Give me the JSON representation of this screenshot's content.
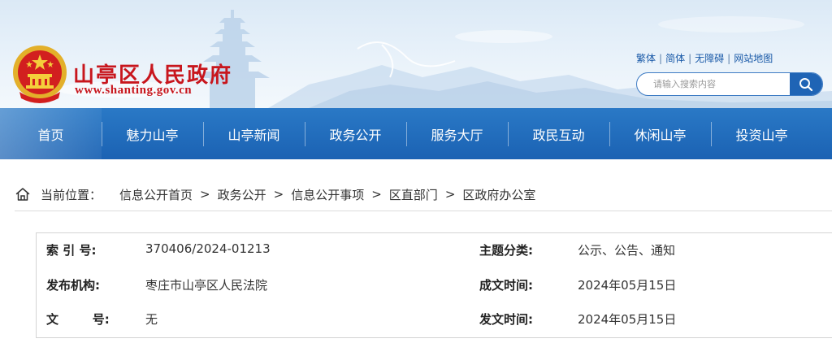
{
  "site": {
    "title": "山亭区人民政府",
    "url": "www.shanting.gov.cn"
  },
  "util_links": [
    "繁体",
    "简体",
    "无障碍",
    "网站地图"
  ],
  "search": {
    "placeholder": "请输入搜索内容",
    "icon": "search-icon"
  },
  "nav": {
    "items": [
      "首页",
      "魅力山亭",
      "山亭新闻",
      "政务公开",
      "服务大厅",
      "政民互动",
      "休闲山亭",
      "投资山亭"
    ],
    "active_index": 0
  },
  "breadcrumb": {
    "prefix": "当前位置：",
    "items": [
      "信息公开首页",
      "政务公开",
      "信息公开事项",
      "区直部门",
      "区政府办公室"
    ],
    "separator": ">",
    "icon": "home-icon"
  },
  "info": {
    "rows": [
      {
        "label1": "索 引 号:",
        "value1": "370406/2024-01213",
        "label2": "主题分类:",
        "value2": "公示、公告、通知"
      },
      {
        "label1": "发布机构:",
        "value1": "枣庄市山亭区人民法院",
        "label2": "成文时间:",
        "value2": "2024年05月15日"
      },
      {
        "label1": "文        号:",
        "value1": "无",
        "label2": "发文时间:",
        "value2": "2024年05月15日"
      }
    ]
  },
  "colors": {
    "brand_red": "#c8161d",
    "nav_blue": "#1f64b5",
    "link_blue": "#1a5aa8"
  }
}
